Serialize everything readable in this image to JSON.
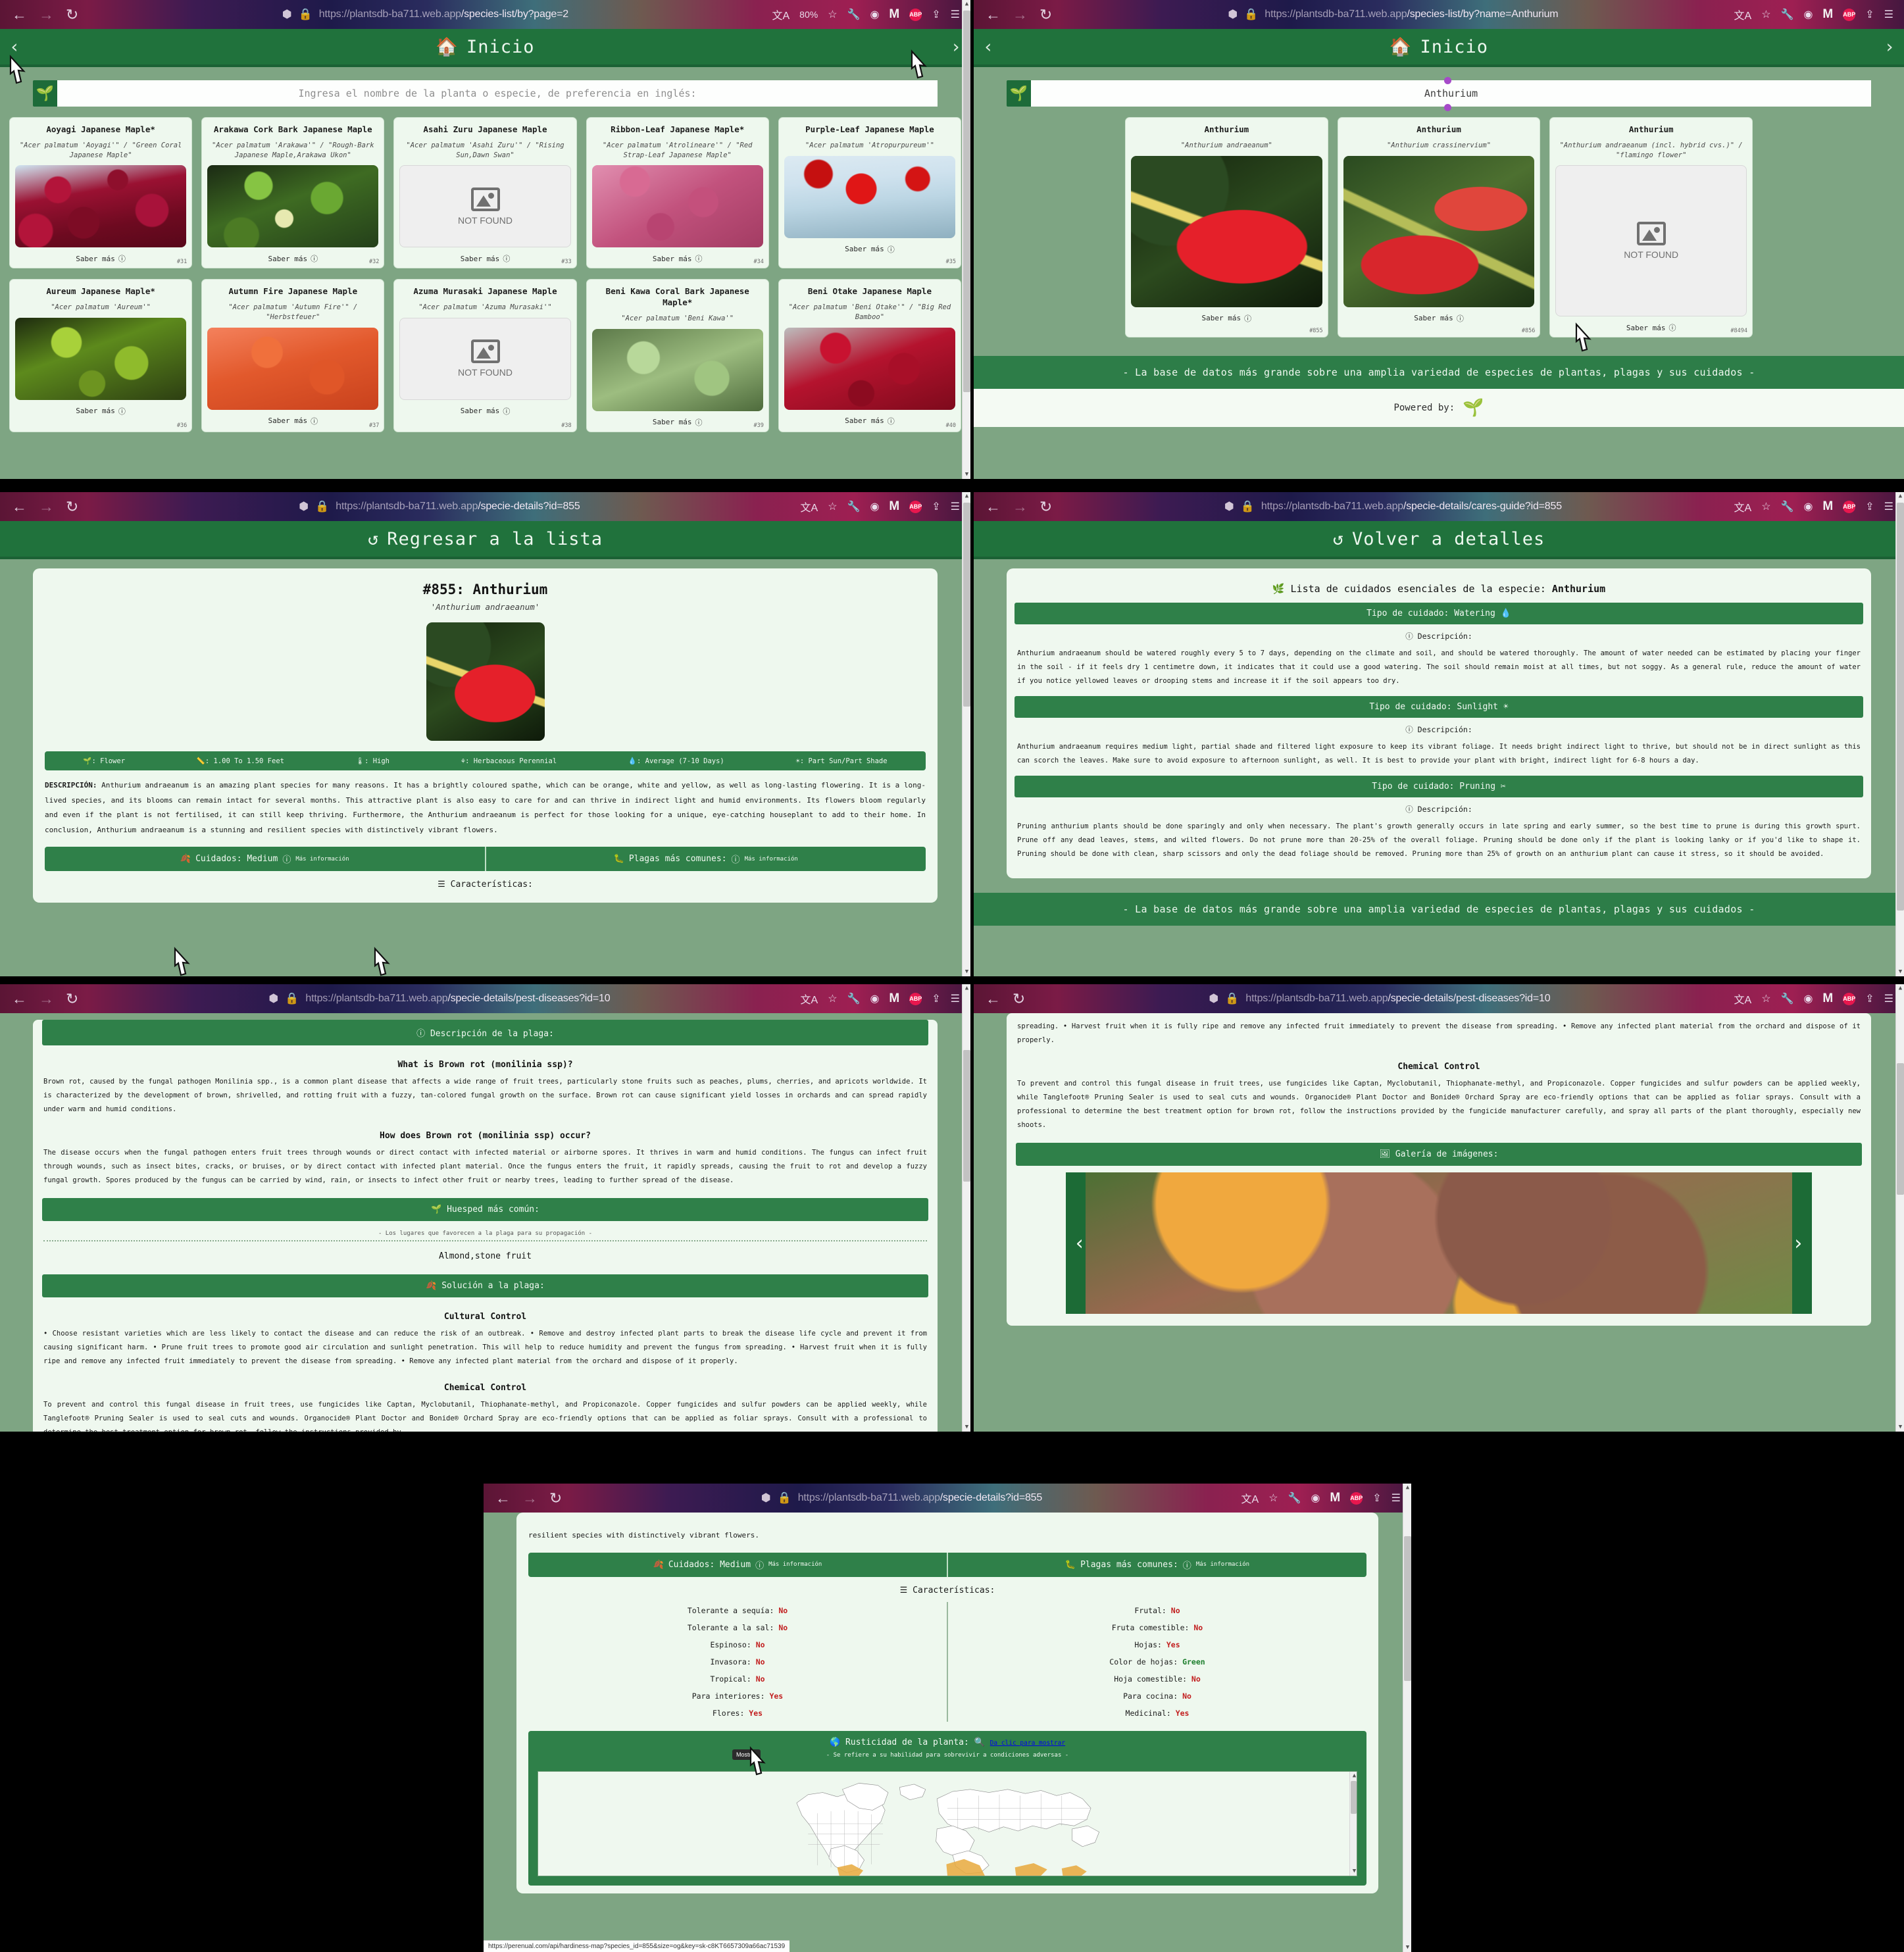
{
  "common": {
    "home_label": "Inicio",
    "saber_mas": "Saber más",
    "search_placeholder": "Ingresa el nombre de la planta o especie, de preferencia en inglés:",
    "footer_tagline": "- La base de datos más grande sobre una amplia variedad de especies de plantas, plagas y sus cuidados -",
    "powered_by": "Powered by:",
    "zoom_level": "80%",
    "back_arrow": "‹",
    "next_arrow": "›",
    "not_found": "NOT FOUND",
    "info_icon": "info-icon",
    "leaf_icon": "seedling-icon"
  },
  "panel1": {
    "url_host": "https://plantsdb-ba711.web.app",
    "url_path": "/species-list/by?page=2",
    "cards_row1": [
      {
        "name": "Aoyagi Japanese Maple*",
        "sci": "\"Acer palmatum 'Aoyagi'\" / \"Green Coral Japanese Maple\"",
        "id": "#31",
        "img": "ph-maple-red",
        "found": true
      },
      {
        "name": "Arakawa Cork Bark Japanese Maple",
        "sci": "\"Acer palmatum 'Arakawa'\" / \"Rough-Bark Japanese Maple,Arakawa Ukon\"",
        "id": "#32",
        "img": "ph-maple-green",
        "found": true
      },
      {
        "name": "Asahi Zuru Japanese Maple",
        "sci": "\"Acer palmatum 'Asahi Zuru'\" / \"Rising Sun,Dawn Swan\"",
        "id": "#33",
        "img": "",
        "found": false
      },
      {
        "name": "Ribbon-Leaf Japanese Maple*",
        "sci": "\"Acer palmatum 'Atrolineare'\" / \"Red Strap-Leaf Japanese Maple\"",
        "id": "#34",
        "img": "ph-maple-pink",
        "found": true
      },
      {
        "name": "Purple-Leaf Japanese Maple",
        "sci": "\"Acer palmatum 'Atropurpureum'\"",
        "id": "#35",
        "img": "ph-maple-bright",
        "found": true
      }
    ],
    "cards_row2": [
      {
        "name": "Aureum Japanese Maple*",
        "sci": "\"Acer palmatum 'Aureum'\"",
        "id": "#36",
        "img": "ph-maple-lime",
        "found": true
      },
      {
        "name": "Autumn Fire Japanese Maple",
        "sci": "\"Acer palmatum 'Autumn Fire'\" / \"Herbstfeuer\"",
        "id": "#37",
        "img": "ph-maple-orange",
        "found": true
      },
      {
        "name": "Azuma Murasaki Japanese Maple",
        "sci": "\"Acer palmatum 'Azuma Murasaki'\"",
        "id": "#38",
        "img": "",
        "found": false
      },
      {
        "name": "Beni Kawa Coral Bark Japanese Maple*",
        "sci": "\"Acer palmatum 'Beni Kawa'\"",
        "id": "#39",
        "img": "ph-maple-palegreen",
        "found": true
      },
      {
        "name": "Beni Otake Japanese Maple",
        "sci": "\"Acer palmatum 'Beni Otake'\" / \"Big Red Bamboo\"",
        "id": "#40",
        "img": "ph-maple-crimson",
        "found": true
      }
    ]
  },
  "panel2": {
    "url_host": "https://plantsdb-ba711.web.app",
    "url_path": "/species-list/by?name=Anthurium",
    "search_value": "Anthurium",
    "cards": [
      {
        "name": "Anthurium",
        "sci": "\"Anthurium andraeanum\"",
        "id": "#855",
        "img": "ph-anth1",
        "found": true
      },
      {
        "name": "Anthurium",
        "sci": "\"Anthurium crassinervium\"",
        "id": "#856",
        "img": "ph-anth2",
        "found": true
      },
      {
        "name": "Anthurium",
        "sci": "\"Anthurium andraeanum (incl. hybrid cvs.)\" / \"flamingo flower\"",
        "id": "#8494",
        "img": "",
        "found": false
      }
    ]
  },
  "panel3": {
    "url_host": "https://plantsdb-ba711.web.app",
    "url_path": "/specie-details?id=855",
    "header": "Regresar a la lista",
    "title": "#855: Anthurium",
    "sci": "'Anthurium andraeanum'",
    "stats": [
      {
        "icon": "flower-icon",
        "label": "Flower"
      },
      {
        "icon": "ruler-icon",
        "label": "1.00 To 1.50 Feet"
      },
      {
        "icon": "thermometer-icon",
        "label": "High"
      },
      {
        "icon": "plant-type-icon",
        "label": "Herbaceous Perennial"
      },
      {
        "icon": "water-drop-icon",
        "label": "Average (7-10 Days)"
      },
      {
        "icon": "sun-icon",
        "label": "Part Sun/Part Shade"
      }
    ],
    "desc_label": "DESCRIPCIÓN:",
    "desc_text": "Anthurium andraeanum is an amazing plant species for many reasons. It has a brightly coloured spathe, which can be orange, white and yellow, as well as long-lasting flowering. It is a long-lived species, and its blooms can remain intact for several months. This attractive plant is also easy to care for and can thrive in indirect light and humid environments. Its flowers bloom regularly and even if the plant is not fertilised, it can still keep thriving. Furthermore, the Anthurium andraeanum is perfect for those looking for a unique, eye-catching houseplant to add to their home. In conclusion, Anthurium andraeanum is a stunning and resilient species with distinctively vibrant flowers.",
    "cuidados_label": "Cuidados: Medium",
    "cuidados_link": "Más información",
    "plagas_label": "Plagas más comunes:",
    "plagas_link": "Más información",
    "caracteristicas_label": "Características:"
  },
  "panel4": {
    "url_host": "https://plantsdb-ba711.web.app",
    "url_path": "/specie-details/cares-guide?id=855",
    "header": "Volver a detalles",
    "card_title_prefix": "Lista de cuidados esenciales de la especie:",
    "species": "Anthurium",
    "desc_label": "Descripción:",
    "cares": [
      {
        "band": "Tipo de cuidado: Watering",
        "icon": "water-drop-icon",
        "text": "Anthurium andraeanum should be watered roughly every 5 to 7 days, depending on the climate and soil, and should be watered thoroughly. The amount of water needed can be estimated by placing your finger in the soil - if it feels dry 1 centimetre down, it indicates that it could use a good watering. The soil should remain moist at all times, but not soggy. As a general rule, reduce the amount of water if you notice yellowed leaves or drooping stems and increase it if the soil appears too dry."
      },
      {
        "band": "Tipo de cuidado: Sunlight",
        "icon": "sun-icon",
        "text": "Anthurium andraeanum requires medium light, partial shade and filtered light exposure to keep its vibrant foliage. It needs bright indirect light to thrive, but should not be in direct sunlight as this can scorch the leaves. Make sure to avoid exposure to afternoon sunlight, as well. It is best to provide your plant with bright, indirect light for 6-8 hours a day."
      },
      {
        "band": "Tipo de cuidado: Pruning",
        "icon": "scissors-icon",
        "text": "Pruning anthurium plants should be done sparingly and only when necessary. The plant's growth generally occurs in late spring and early summer, so the best time to prune is during this growth spurt. Prune off any dead leaves, stems, and wilted flowers. Do not prune more than 20-25% of the overall foliage. Pruning should be done only if the plant is looking lanky or if you'd like to shape it. Pruning should be done with clean, sharp scissors and only the dead foliage should be removed. Pruning more than 25% of growth on an anthurium plant can cause it stress, so it should be avoided."
      }
    ]
  },
  "panel5": {
    "url_host": "https://plantsdb-ba711.web.app",
    "url_path": "/specie-details/pest-diseases?id=10",
    "band_desc": "Descripción de la plaga:",
    "h_what": "What is Brown rot (monilinia ssp)?",
    "p_what": "Brown rot, caused by the fungal pathogen Monilinia spp., is a common plant disease that affects a wide range of fruit trees, particularly stone fruits such as peaches, plums, cherries, and apricots worldwide. It is characterized by the development of brown, shrivelled, and rotting fruit with a fuzzy, tan-colored fungal growth on the surface. Brown rot can cause significant yield losses in orchards and can spread rapidly under warm and humid conditions.",
    "h_how": "How does Brown rot (monilinia ssp) occur?",
    "p_how": "The disease occurs when the fungal pathogen enters fruit trees through wounds or direct contact with infected material or airborne spores. It thrives in warm and humid conditions. The fungus can infect fruit through wounds, such as insect bites, cracks, or bruises, or by direct contact with infected plant material. Once the fungus enters the fruit, it rapidly spreads, causing the fruit to rot and develop a fuzzy fungal growth. Spores produced by the fungus can be carried by wind, rain, or insects to infect other fruit or nearby trees, leading to further spread of the disease.",
    "band_host": "Huesped más común:",
    "host_sub": "- Los lugares que favorecen a la plaga para su propagación -",
    "host_value": "Almond,stone fruit",
    "band_solution": "Solución a la plaga:",
    "h_cultural": "Cultural Control",
    "p_cultural": "• Choose resistant varieties which are less likely to contact the disease and can reduce the risk of an outbreak. • Remove and destroy infected plant parts to break the disease life cycle and prevent it from causing significant harm. • Prune fruit trees to promote good air circulation and sunlight penetration. This will help to reduce humidity and prevent the fungus from spreading. • Harvest fruit when it is fully ripe and remove any infected fruit immediately to prevent the disease from spreading. • Remove any infected plant material from the orchard and dispose of it properly.",
    "h_chemical": "Chemical Control",
    "p_chemical": "To prevent and control this fungal disease in fruit trees, use fungicides like Captan, Myclobutanil, Thiophanate-methyl, and Propiconazole. Copper fungicides and sulfur powders can be applied weekly, while Tanglefoot® Pruning Sealer is used to seal cuts and wounds. Organocide® Plant Doctor and Bonide® Orchard Spray are eco-friendly options that can be applied as foliar sprays. Consult with a professional to determine the best treatment option for brown rot, follow the instructions provided by"
  },
  "panel6": {
    "url_host": "https://plantsdb-ba711.web.app",
    "url_path": "/specie-details/pest-diseases?id=10",
    "p_cultural_tail": "spreading. • Harvest fruit when it is fully ripe and remove any infected fruit immediately to prevent the disease from spreading. • Remove any infected plant material from the orchard and dispose of it properly.",
    "h_chemical": "Chemical Control",
    "p_chemical": "To prevent and control this fungal disease in fruit trees, use fungicides like Captan, Myclobutanil, Thiophanate-methyl, and Propiconazole. Copper fungicides and sulfur powders can be applied weekly, while Tanglefoot® Pruning Sealer is used to seal cuts and wounds. Organocide® Plant Doctor and Bonide® Orchard Spray are eco-friendly options that can be applied as foliar sprays. Consult with a professional to determine the best treatment option for brown rot, follow the instructions provided by the fungicide manufacturer carefully, and spray all parts of the plant thoroughly, especially new shoots.",
    "band_gallery": "Galería de imágenes:",
    "prev_arrow": "‹",
    "next_arrow": "›"
  },
  "panel7": {
    "url_host": "https://plantsdb-ba711.web.app",
    "url_path": "/specie-details?id=855",
    "desc_tail": "resilient species with distinctively vibrant flowers.",
    "cuidados_label": "Cuidados: Medium",
    "cuidados_link": "Más información",
    "plagas_label": "Plagas más comunes:",
    "plagas_link": "Más información",
    "caracteristicas_label": "Características:",
    "chars_left": [
      {
        "k": "Tolerante a sequía:",
        "v": "No",
        "color": "red"
      },
      {
        "k": "Tolerante a la sal:",
        "v": "No",
        "color": "red"
      },
      {
        "k": "Espinoso:",
        "v": "No",
        "color": "red"
      },
      {
        "k": "Invasora:",
        "v": "No",
        "color": "red"
      },
      {
        "k": "Tropical:",
        "v": "No",
        "color": "red"
      },
      {
        "k": "Para interiores:",
        "v": "Yes",
        "color": "red"
      },
      {
        "k": "Flores:",
        "v": "Yes",
        "color": "red"
      }
    ],
    "chars_right": [
      {
        "k": "Frutal:",
        "v": "No",
        "color": "red"
      },
      {
        "k": "Fruta comestible:",
        "v": "No",
        "color": "red"
      },
      {
        "k": "Hojas:",
        "v": "Yes",
        "color": "red"
      },
      {
        "k": "Color de hojas:",
        "v": "Green",
        "color": "green"
      },
      {
        "k": "Hoja comestible:",
        "v": "No",
        "color": "red"
      },
      {
        "k": "Para cocina:",
        "v": "No",
        "color": "red"
      },
      {
        "k": "Medicinal:",
        "v": "Yes",
        "color": "red"
      }
    ],
    "rust_label": "Rusticidad de la planta:",
    "rust_link": "Da clic para mostrar",
    "rust_sub": "- Se refiere a su habilidad para sobrevivir a condiciones adversas -",
    "tooltip": "Mostrar",
    "status_url": "https://perenual.com/api/hardiness-map?species_id=855&size=og&key=sk-c8KT6657309a66ac71539"
  }
}
